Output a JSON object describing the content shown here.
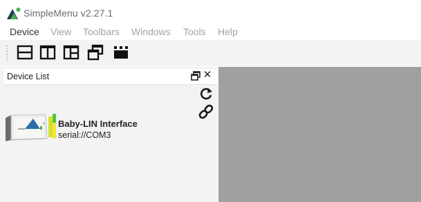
{
  "window": {
    "title": "SimpleMenu v2.27.1"
  },
  "menu": {
    "items": [
      {
        "label": "Device"
      },
      {
        "label": "View"
      },
      {
        "label": "Toolbars"
      },
      {
        "label": "Windows"
      },
      {
        "label": "Tools"
      },
      {
        "label": "Help"
      }
    ]
  },
  "toolbar": {
    "buttons": [
      {
        "icon": "split-horizontal-icon"
      },
      {
        "icon": "split-vertical-icon"
      },
      {
        "icon": "split-layout-icon"
      },
      {
        "icon": "cascade-windows-icon"
      },
      {
        "icon": "film-strip-icon"
      }
    ]
  },
  "device_list": {
    "title": "Device List",
    "close_glyph": "✕",
    "devices": [
      {
        "name": "Baby-LIN Interface",
        "port": "serial://COM3",
        "image_label": "Baby-LIN",
        "status_color": "#58c43a"
      }
    ]
  },
  "colors": {
    "workspace": "#a0a0a0",
    "panel": "#f3f3f3",
    "logo_green": "#4cb04a",
    "logo_dark": "#1f3a5c"
  }
}
